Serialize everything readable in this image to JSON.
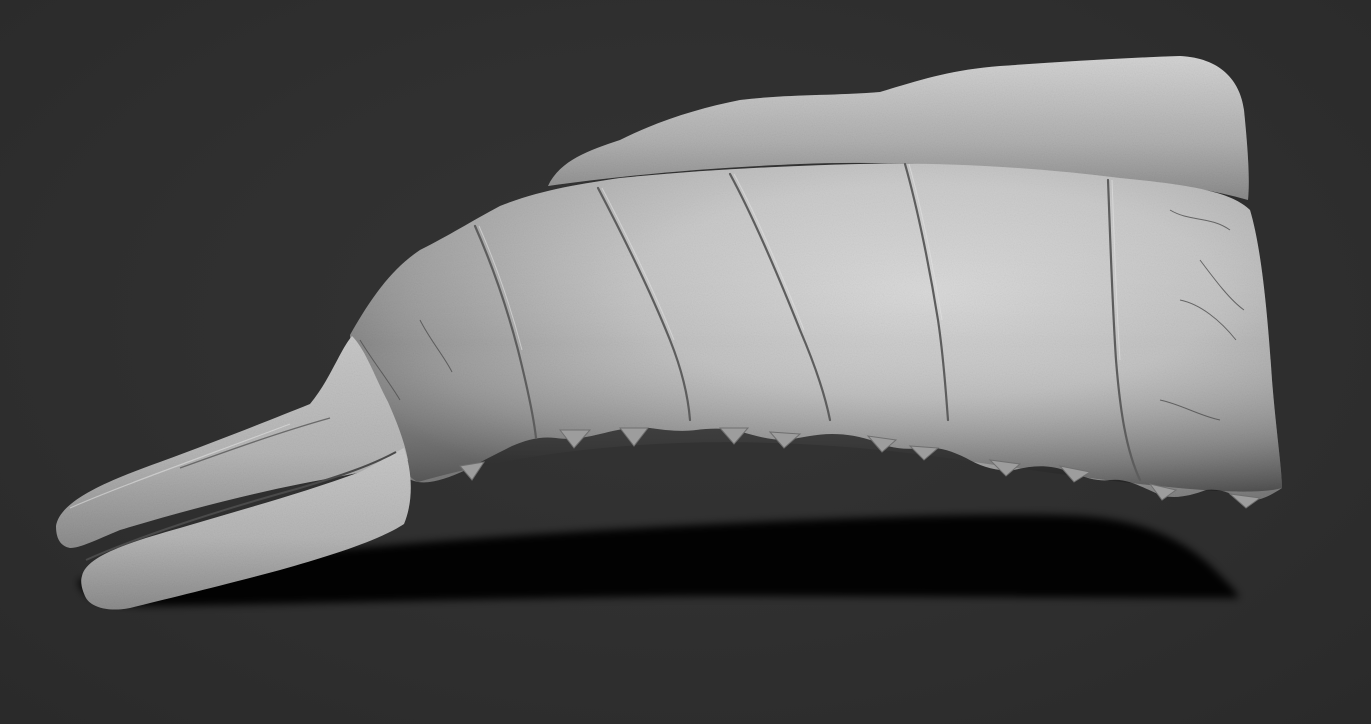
{
  "scene": {
    "background_color": "#2e2e2e",
    "shadow_color": "#000000",
    "model_base_color": "#b9b9b9",
    "model_highlight_color": "#dcdcdc",
    "model_shade_color": "#6f6f6f"
  }
}
